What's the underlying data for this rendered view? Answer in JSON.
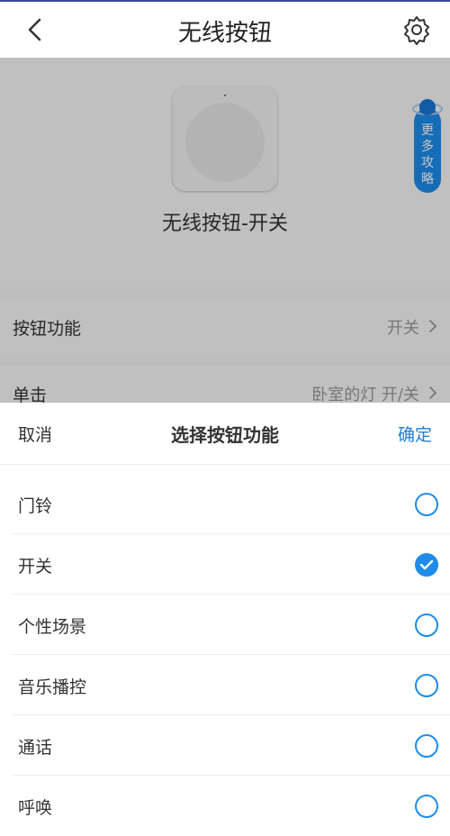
{
  "header": {
    "title": "无线按钮",
    "back_icon": "chevron-left-icon",
    "settings_icon": "gear-icon"
  },
  "device": {
    "name": "无线按钮-开关"
  },
  "strategy_badge": {
    "label": "更多攻略"
  },
  "settings_rows": [
    {
      "label": "按钮功能",
      "value": "开关"
    },
    {
      "label": "单击",
      "value": "卧室的灯 开/关"
    }
  ],
  "sheet": {
    "cancel_label": "取消",
    "title": "选择按钮功能",
    "confirm_label": "确定",
    "options": [
      {
        "label": "门铃",
        "selected": false
      },
      {
        "label": "开关",
        "selected": true
      },
      {
        "label": "个性场景",
        "selected": false
      },
      {
        "label": "音乐播控",
        "selected": false
      },
      {
        "label": "通话",
        "selected": false
      },
      {
        "label": "呼唤",
        "selected": false
      }
    ]
  },
  "colors": {
    "accent": "#1e8ce8",
    "confirm": "#1e7ed8",
    "overlay": "rgba(0,0,0,0.22)"
  }
}
